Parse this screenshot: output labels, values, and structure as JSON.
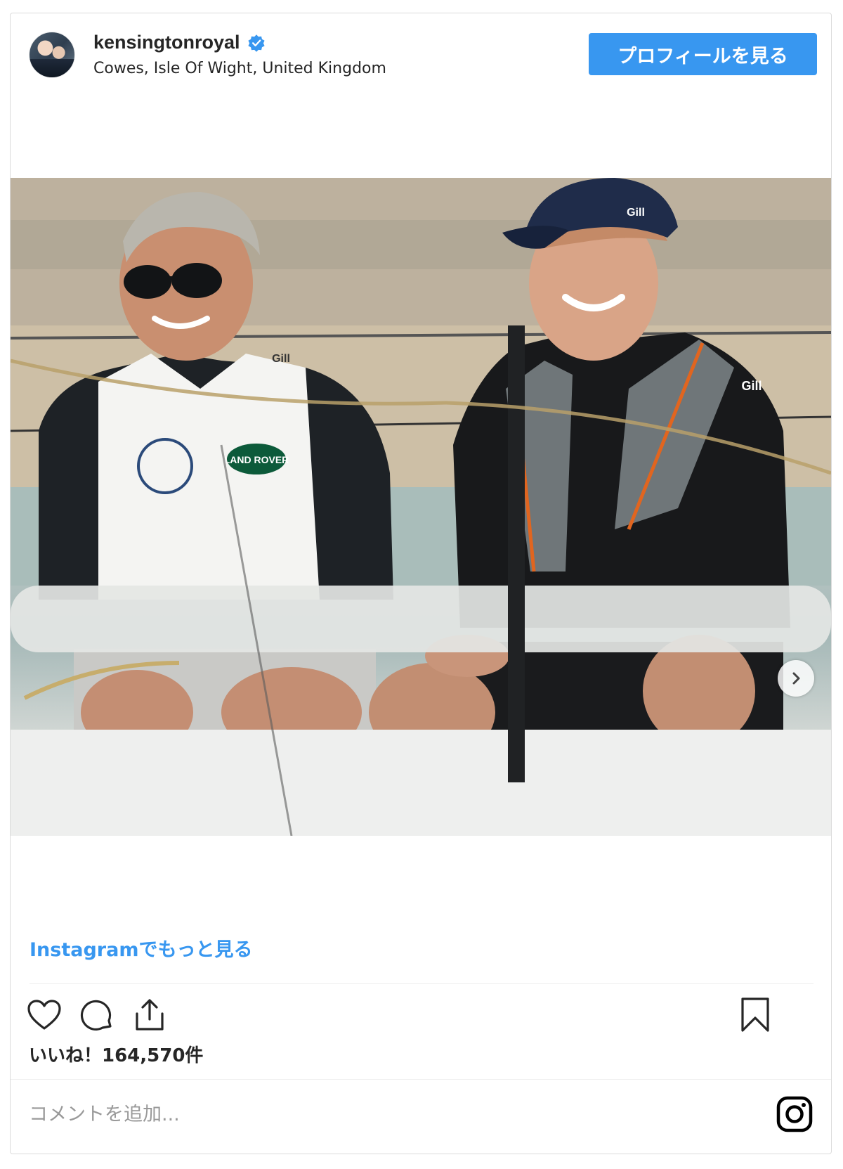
{
  "post": {
    "username": "kensingtonroyal",
    "location": "Cowes, Isle Of Wight, United Kingdom",
    "profile_button": "プロフィールを見る",
    "more_link": "Instagramでもっと見る",
    "likes": "いいね！164,570件",
    "comment_placeholder": "コメントを追加...",
    "photo": {
      "vest_logo_text_1": "Gill",
      "vest_logo_text_2": "LAND ROVER",
      "cap_logo_text": "Gill",
      "jacket_logo_text": "Gill"
    }
  },
  "icons": {
    "verified": "verified-badge-icon",
    "next": "chevron-right-icon",
    "like": "heart-icon",
    "comment": "comment-bubble-icon",
    "share": "share-icon",
    "save": "bookmark-icon",
    "instagram": "instagram-logo-icon"
  },
  "colors": {
    "accent": "#3897f0",
    "text": "#262626",
    "muted": "#999999",
    "border": "#dbdbdb"
  }
}
